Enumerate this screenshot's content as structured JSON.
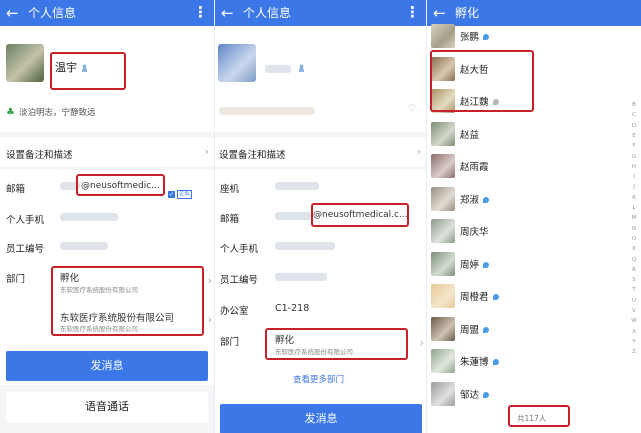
{
  "panel1": {
    "title": "个人信息",
    "name": "温宇",
    "signature": "淡泊明志，宁静致远",
    "remark_label": "设置备注和描述",
    "email_label": "邮箱",
    "email_value": "@neusoftmedic...",
    "email_tag": "企业",
    "phone_label": "个人手机",
    "empid_label": "员工编号",
    "dept_label": "部门",
    "dept1_name": "孵化",
    "dept1_company": "东软医疗系统股份有限公司",
    "dept2_name": "东软医疗系统股份有限公司",
    "dept2_company": "东软医疗系统股份有限公司",
    "send_button": "发消息",
    "voice_button": "语音通话"
  },
  "panel2": {
    "title": "个人信息",
    "remark_label": "设置备注和描述",
    "seat_label": "座机",
    "email_label": "邮箱",
    "email_value": "@neusoftmedical.c...",
    "phone_label": "个人手机",
    "empid_label": "员工编号",
    "office_label": "办公室",
    "office_value": "C1-218",
    "dept_label": "部门",
    "dept_name": "孵化",
    "dept_company": "东软医疗系统股份有限公司",
    "more_depts": "查看更多部门",
    "send_button": "发消息"
  },
  "panel3": {
    "title": "孵化",
    "contacts": [
      {
        "name": "张鹏",
        "badge": "blue"
      },
      {
        "name": "赵大哲",
        "badge": "none"
      },
      {
        "name": "赵江魏",
        "badge": "grey"
      },
      {
        "name": "赵益",
        "badge": "none"
      },
      {
        "name": "赵雨霞",
        "badge": "none"
      },
      {
        "name": "郑淑",
        "badge": "blue"
      },
      {
        "name": "周庆华",
        "badge": "none"
      },
      {
        "name": "周婷",
        "badge": "blue"
      },
      {
        "name": "周橙君",
        "badge": "blue"
      },
      {
        "name": "周盟",
        "badge": "blue"
      },
      {
        "name": "朱蓮博",
        "badge": "blue"
      },
      {
        "name": "邹达",
        "badge": "blue"
      }
    ],
    "index_letters": [
      "B",
      "C",
      "D",
      "E",
      "F",
      "G",
      "H",
      "I",
      "J",
      "K",
      "L",
      "M",
      "N",
      "O",
      "P",
      "Q",
      "R",
      "S",
      "T",
      "U",
      "V",
      "W",
      "X",
      "Y",
      "Z"
    ],
    "total": "共117人"
  },
  "colors": {
    "accent": "#3b77e6",
    "highlight_box": "#c8202a",
    "verified_badge": "#4a9be8"
  },
  "icons": {
    "back": "arrow-left-icon",
    "more": "more-vertical-icon",
    "chevron": "chevron-right-icon",
    "heart": "heart-icon",
    "person": "person-icon",
    "leaf": "leaf-icon"
  }
}
